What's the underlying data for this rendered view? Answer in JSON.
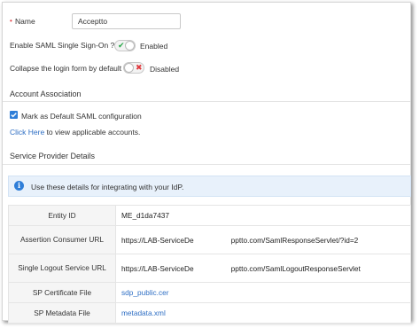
{
  "form": {
    "name_required_mark": "•",
    "name_label": "Name",
    "name_value": "Acceptto",
    "saml_sso_label": "Enable SAML Single Sign-On ?",
    "saml_sso_state": "Enabled",
    "collapse_label": "Collapse the login form by default",
    "collapse_state": "Disabled"
  },
  "account_association": {
    "heading": "Account Association",
    "checkbox_label": "Mark as Default SAML configuration",
    "checkbox_checked": true,
    "link_text": "Click Here",
    "link_suffix": " to view applicable accounts."
  },
  "service_provider": {
    "heading": "Service Provider Details",
    "info_text": "Use these details for integrating with your IdP.",
    "rows": [
      {
        "key": "Entity ID",
        "value": "ME_d1da7437"
      },
      {
        "key": "Assertion Consumer URL",
        "value": "https://LAB-ServiceDe",
        "value_tail": "pptto.com/SamlResponseServlet/?id=2"
      },
      {
        "key": "Single Logout Service URL",
        "value": "https://LAB-ServiceDe",
        "value_tail": "pptto.com/SamlLogoutResponseServlet"
      },
      {
        "key": "SP Certificate File",
        "value": "sdp_public.cer"
      },
      {
        "key": "SP Metadata File",
        "value": "metadata.xml"
      }
    ]
  },
  "colors": {
    "accent": "#2f7ed8",
    "link": "#2f6fc4",
    "required": "#e0393e",
    "enabled_check": "#2aa84a",
    "disabled_x": "#e0393e",
    "info_bg": "#e8f1fb"
  }
}
